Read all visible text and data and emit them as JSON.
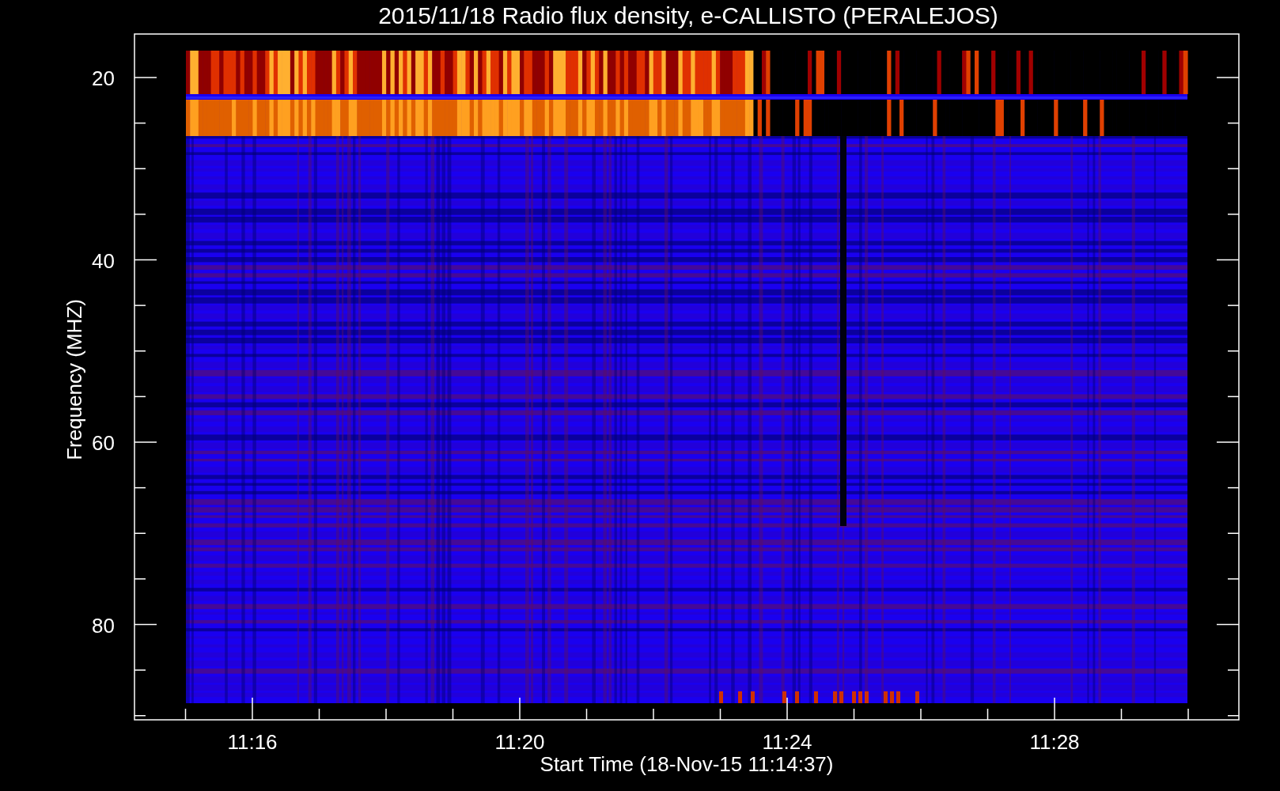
{
  "plot": {
    "title": "2015/11/18  Radio flux density, e-CALLISTO (PERALEJOS)",
    "ylabel": "Frequency (MHZ)",
    "xlabel": "Start Time (18-Nov-15 11:14:37)",
    "yticks": [
      "20",
      "40",
      "60",
      "80"
    ],
    "xticks": [
      "11:16",
      "11:20",
      "11:24",
      "11:28"
    ]
  }
}
